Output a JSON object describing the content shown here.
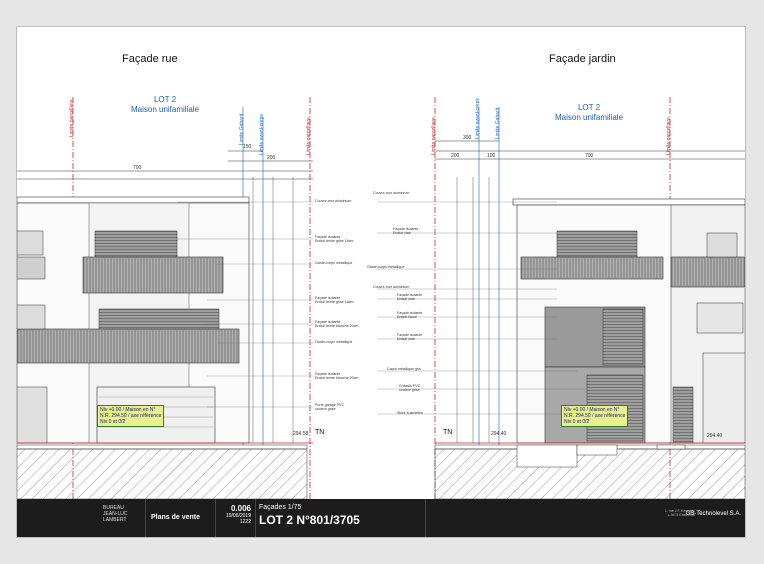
{
  "titles": {
    "left": "Façade rue",
    "right": "Façade jardin"
  },
  "lot_left": {
    "line1": "LOT 2",
    "line2": "Maison unifamiliale"
  },
  "lot_right": {
    "line1": "LOT 2",
    "line2": "Maison unifamiliale"
  },
  "vertical_labels": {
    "limite_parcellaire": "Limite parcellaire",
    "limite_gabarit": "Limite Gabarit",
    "limite_avant_corps": "Limite avant-corps"
  },
  "dimensions": {
    "left_150": "150",
    "left_200": "200",
    "left_700": "700",
    "right_300": "300",
    "right_200": "200",
    "right_100": "100",
    "right_700": "700"
  },
  "notes_left": [
    "Couvre-mur aluminium",
    "Façade isolante\nEnduit teinte grise 18cm",
    "Garde-corps métallique",
    "Façade isolante\nEnduit teinte grise 18cm",
    "Façade isolante\nEnduit teinte blanche 20cm",
    "Garde-corps métallique",
    "Façade isolante\nEnduit teinte blanche 20cm",
    "Porte garage PVC\ncouleur grise"
  ],
  "notes_right": [
    "Couvre-mur aluminium",
    "Façade isolante\nEnduit clair",
    "Garde-corps métallique",
    "Couvre-mur aluminium",
    "Façade isolante\nEnduit clair",
    "Façade isolante\nEnduit foncé",
    "Façade isolante\nEnduit clair",
    "Capot métallique gris",
    "Châssis PVC\ncouleur grise",
    "Store à lamelles"
  ],
  "levels": {
    "left_tn": "TN",
    "left_level": "294.58",
    "right_tn": "TN",
    "right_level": "294.40",
    "right_level2": "294.40"
  },
  "callouts": {
    "left": "Niv +0.00 / Maison en N°\nN.R. 294.50 / axe référence\nNiv 0 et 0/2",
    "right": "Niv +0.00 / Maison en N°\nN.R. 294.50 / axe référence\nNiv 0 et 0/2"
  },
  "titleblock": {
    "logo_text": "BUREAU\nJEAN-LUC\nLAMBERT",
    "plans_de_vente": "Plans de vente",
    "number": "0.006",
    "date": "19/06/2019",
    "code": "1222",
    "scale": "Façades 1/75",
    "lot_title": "LOT 2 N°801/3705",
    "company": "GB-Technolevel S.A.",
    "company_small": "1, rue J.F. Kennedy\nL-9474 Ettelbruck"
  },
  "colors": {
    "limit_red": "#c62828",
    "limit_blue": "#1565c0",
    "callout_bg": "#e8f08a"
  }
}
